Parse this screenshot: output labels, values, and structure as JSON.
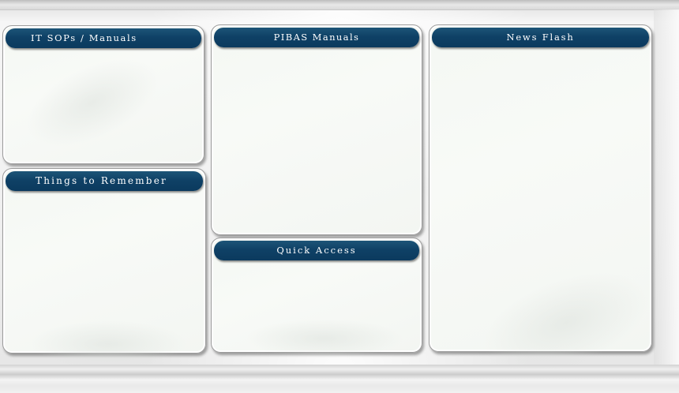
{
  "panels": {
    "it_sops": {
      "title": "IT SOPs / Manuals"
    },
    "things_to_remember": {
      "title": "Things to Remember"
    },
    "pibas_manuals": {
      "title": "PIBAS Manuals"
    },
    "quick_access": {
      "title": "Quick Access"
    },
    "news_flash": {
      "title": "News Flash"
    }
  },
  "colors": {
    "header_bg": "#0f4166",
    "header_text": "#ffffff",
    "panel_bg": "#f6f9f5",
    "panel_border": "#9c9c9c"
  }
}
